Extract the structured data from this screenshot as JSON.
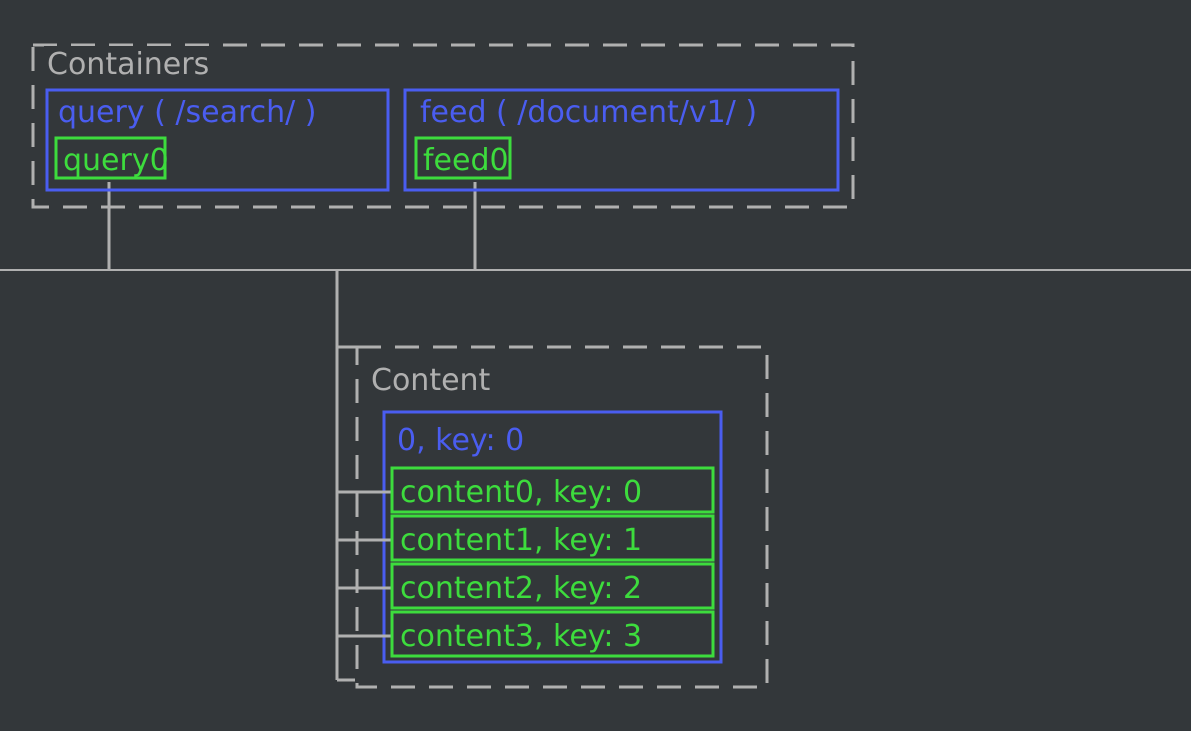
{
  "containers": {
    "label": "Containers",
    "query": {
      "title": "query ( /search/ )",
      "node": "query0"
    },
    "feed": {
      "title": "feed ( /document/v1/ )",
      "node": "feed0"
    }
  },
  "content": {
    "label": "Content",
    "header": "0, key: 0",
    "rows": [
      "content0, key: 0",
      "content1, key: 1",
      "content2, key: 2",
      "content3, key: 3"
    ]
  }
}
